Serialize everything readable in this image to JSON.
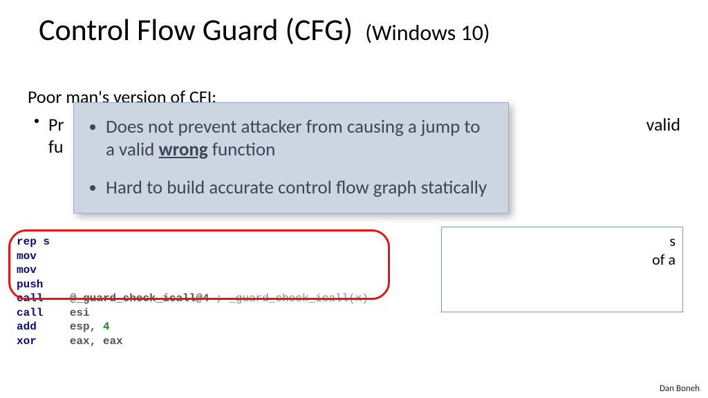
{
  "title": {
    "main": "Control Flow Guard (CFG)",
    "sub": "(Windows 10)"
  },
  "body": {
    "intro": "Poor man's version of CFI:",
    "bullet_left": "Pr",
    "bullet_left_line2": "fu",
    "right_fragment1": "valid"
  },
  "right_box": {
    "line1_tail": "s",
    "line2_tail": "of a"
  },
  "callout": {
    "item1_pre": "Does not prevent attacker from causing a jump to a valid ",
    "item1_u": "wrong",
    "item1_post": " function",
    "item2": "Hard to build accurate control flow graph statically"
  },
  "code": {
    "l1_a": "rep s",
    "l1_b": "",
    "l2_a": "mov",
    "l2_b": "",
    "l3_a": "mov",
    "l3_b": "",
    "l4_a": "push",
    "l4_b": "",
    "l5_a": "call",
    "l5_b": "@_guard_check_icall@4",
    "l5_c": " ; _guard_check_icall(x)",
    "l6_a": "call",
    "l6_b": "esi",
    "l7_a": "add",
    "l7_b": "esp, ",
    "l7_n": "4",
    "l8_a": "xor",
    "l8_b": "eax, eax"
  },
  "footer": "Dan Boneh"
}
